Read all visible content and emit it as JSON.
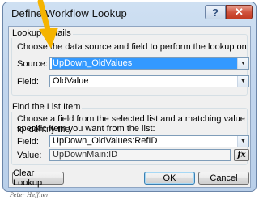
{
  "dialog": {
    "title": "Define Workflow Lookup",
    "help_label": "?",
    "close_label": "✕"
  },
  "lookup_details": {
    "legend": "Lookup Details",
    "instructions": "Choose the data source and field to perform the lookup on:",
    "source_label": "Source:",
    "source_value": "UpDown_OldValues",
    "field_label": "Field:",
    "field_value": "OldValue"
  },
  "find_list_item": {
    "legend": "Find the List Item",
    "instructions_line1": "Choose a field from the selected list and a matching value to identify the",
    "instructions_line2": "specific item you want from the list:",
    "field_label": "Field:",
    "field_value": "UpDown_OldValues:RefID",
    "value_label": "Value:",
    "value_value": "UpDownMain:ID",
    "fx_label": "fx"
  },
  "buttons": {
    "clear_lookup": "Clear Lookup",
    "ok": "OK",
    "cancel": "Cancel"
  },
  "signature": "Peter Heffner",
  "colors": {
    "frame": "#c2d6ee",
    "selection": "#3399ff",
    "close_button": "#d0533d",
    "pointer_arrow": "#f5b400"
  }
}
